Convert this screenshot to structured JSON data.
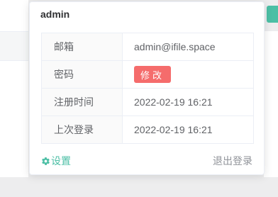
{
  "popover": {
    "title": "admin",
    "rows": [
      {
        "label": "邮箱",
        "value": "admin@ifile.space"
      },
      {
        "label": "密码",
        "button": "修改"
      },
      {
        "label": "注册时间",
        "value": "2022-02-19 16:21"
      },
      {
        "label": "上次登录",
        "value": "2022-02-19 16:21"
      }
    ],
    "footer": {
      "settings_label": "设置",
      "settings_icon": "gear-icon",
      "logout_label": "退出登录"
    }
  },
  "colors": {
    "accent": "#4cbfa5",
    "danger": "#f56c6c"
  }
}
